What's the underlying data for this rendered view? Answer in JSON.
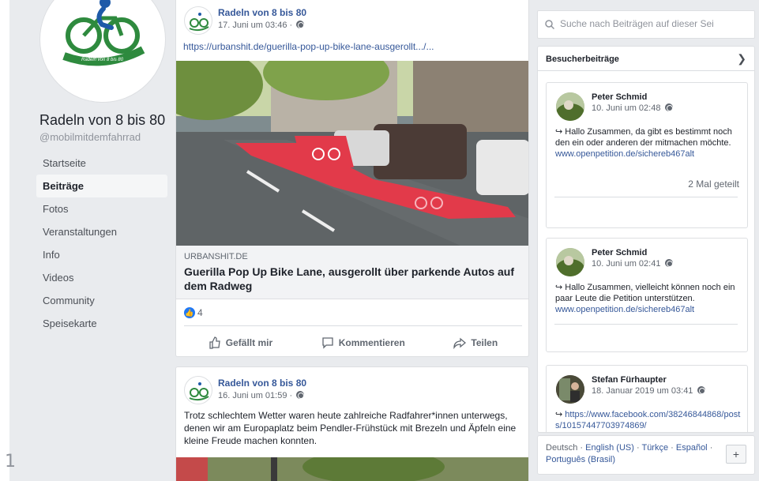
{
  "page_number": "1",
  "page": {
    "name": "Radeln von 8 bis 80",
    "handle": "@mobilmitdemfahrrad",
    "logo_text": "Radeln von 8 bis 80"
  },
  "nav": [
    {
      "label": "Startseite",
      "active": false
    },
    {
      "label": "Beiträge",
      "active": true
    },
    {
      "label": "Fotos",
      "active": false
    },
    {
      "label": "Veranstaltungen",
      "active": false
    },
    {
      "label": "Info",
      "active": false
    },
    {
      "label": "Videos",
      "active": false
    },
    {
      "label": "Community",
      "active": false
    },
    {
      "label": "Speisekarte",
      "active": false
    }
  ],
  "post1": {
    "author": "Radeln von 8 bis 80",
    "time": "17. Juni um 03:46 ·",
    "url": "https://urbanshit.de/guerilla-pop-up-bike-lane-ausgerollt.../...",
    "link_domain": "URBANSHIT.DE",
    "link_title": "Guerilla Pop Up Bike Lane, ausgerollt über parkende Autos auf dem Radweg",
    "like_count": "4",
    "actions": {
      "like": "Gefällt mir",
      "comment": "Kommentieren",
      "share": "Teilen"
    }
  },
  "post2": {
    "author": "Radeln von 8 bis 80",
    "time": "16. Juni um 01:59 ·",
    "text": "Trotz schlechtem Wetter waren heute zahlreiche Radfahrer*innen unterwegs, denen wir am Europaplatz beim Pendler-Frühstück mit Brezeln und Äpfeln eine kleine Freude machen konnten."
  },
  "search": {
    "placeholder": "Suche nach Beiträgen auf dieser Sei"
  },
  "visitor_posts": {
    "title": "Besucherbeiträge",
    "items": [
      {
        "name": "Peter Schmid",
        "time": "10. Juni um 02:48",
        "text": "Hallo Zusammen, da gibt es bestimmt noch den ein oder anderen der mitmachen möchte.",
        "link": "www.openpetition.de/sichereb467alt",
        "shares": "2 Mal geteilt"
      },
      {
        "name": "Peter Schmid",
        "time": "10. Juni um 02:41",
        "text": "Hallo Zusammen, vielleicht können noch ein paar Leute die Petition unterstützen.",
        "link": "www.openpetition.de/sichereb467alt"
      },
      {
        "name": "Stefan Fürhaupter",
        "time": "18. Januar 2019 um 03:41",
        "link": "https://www.facebook.com/38246844868/posts/10157447703974869/"
      }
    ]
  },
  "footer": {
    "langs": [
      "Deutsch",
      "English (US)",
      "Türkçe",
      "Español",
      "Português (Brasil)"
    ],
    "plus": "+"
  }
}
